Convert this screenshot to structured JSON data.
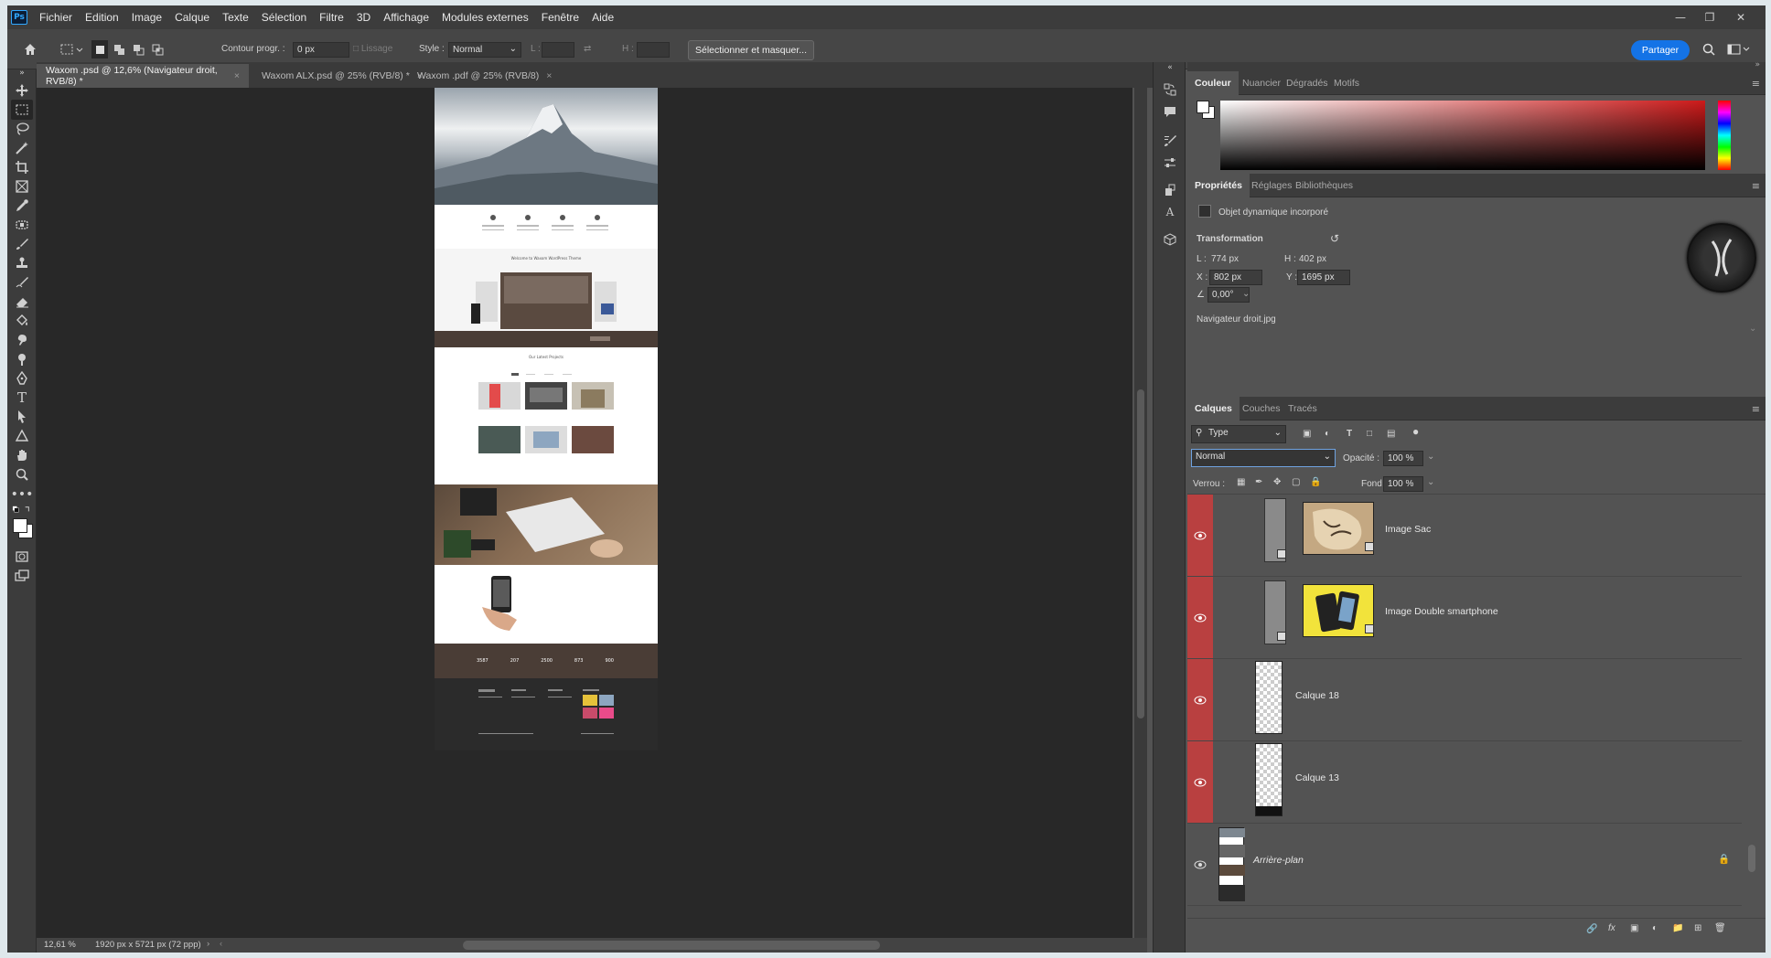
{
  "app": {
    "logo": "Ps"
  },
  "menu": [
    "Fichier",
    "Edition",
    "Image",
    "Calque",
    "Texte",
    "Sélection",
    "Filtre",
    "3D",
    "Affichage",
    "Modules externes",
    "Fenêtre",
    "Aide"
  ],
  "options": {
    "contour_label": "Contour progr. :",
    "contour_value": "0 px",
    "lissage": "Lissage",
    "style_label": "Style :",
    "style_value": "Normal",
    "l_label": "L :",
    "h_label": "H :",
    "select_mask": "Sélectionner et masquer...",
    "share": "Partager"
  },
  "tabs": [
    {
      "label": "Waxom .psd @ 12,6% (Navigateur droit, RVB/8) *",
      "active": true
    },
    {
      "label": "Waxom ALX.psd @ 25% (RVB/8) *",
      "active": false
    },
    {
      "label": "Waxom .pdf @ 25% (RVB/8)",
      "active": false
    }
  ],
  "status": {
    "zoom": "12,61 %",
    "dims": "1920 px x 5721 px (72 ppp)"
  },
  "color_panel": {
    "tabs": [
      "Couleur",
      "Nuancier",
      "Dégradés",
      "Motifs"
    ],
    "hue_color": "#cc1a1a"
  },
  "props_panel": {
    "tabs": [
      "Propriétés",
      "Réglages",
      "Bibliothèques"
    ],
    "object_type": "Objet dynamique incorporé",
    "section": "Transformation",
    "l_label": "L :",
    "l_value": "774 px",
    "h_label": "H :",
    "h_value": "402 px",
    "x_label": "X :",
    "x_value": "802 px",
    "y_label": "Y :",
    "y_value": "1695 px",
    "angle": "0,00°",
    "file": "Navigateur droit.jpg"
  },
  "layers_panel": {
    "tabs": [
      "Calques",
      "Couches",
      "Tracés"
    ],
    "filter": "Type",
    "blend": "Normal",
    "opacity_label": "Opacité :",
    "opacity": "100 %",
    "lock_label": "Verrou :",
    "fill_label": "Fond :",
    "fill": "100 %",
    "layers": [
      {
        "name": "Image Sac"
      },
      {
        "name": "Image Double smartphone"
      },
      {
        "name": "Calque 18"
      },
      {
        "name": "Calque 13"
      },
      {
        "name": "Arrière-plan"
      }
    ]
  },
  "artboard": {
    "welcome": "Welcome to Waxom WordPress Theme",
    "projects": "Our Latest Projects",
    "stats": [
      "3587",
      "207",
      "2500",
      "873",
      "900"
    ]
  }
}
